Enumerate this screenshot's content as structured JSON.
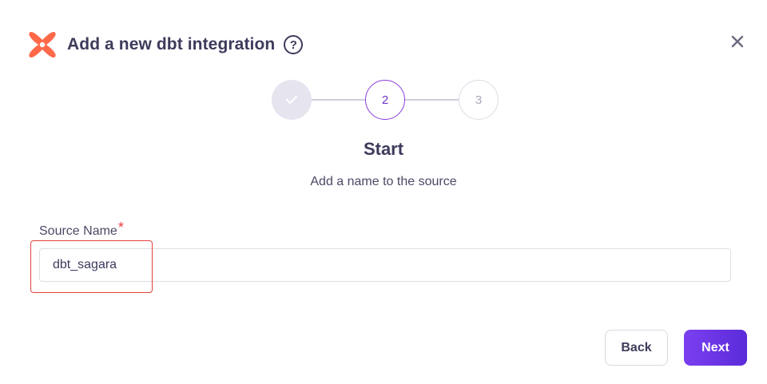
{
  "modal": {
    "title": "Add a new dbt integration",
    "help_symbol": "?"
  },
  "stepper": {
    "steps": [
      {
        "label": "",
        "status": "completed"
      },
      {
        "label": "2",
        "status": "active"
      },
      {
        "label": "3",
        "status": "pending"
      }
    ]
  },
  "step": {
    "title": "Start",
    "subtitle": "Add a name to the source"
  },
  "form": {
    "source_name_label": "Source Name",
    "required_marker": "*",
    "source_name_value": "dbt_sagara"
  },
  "buttons": {
    "back": "Back",
    "next": "Next"
  },
  "colors": {
    "brand_orange": "#ff694a",
    "accent_purple": "#7b3ff0",
    "highlight_red": "#e5413c"
  }
}
